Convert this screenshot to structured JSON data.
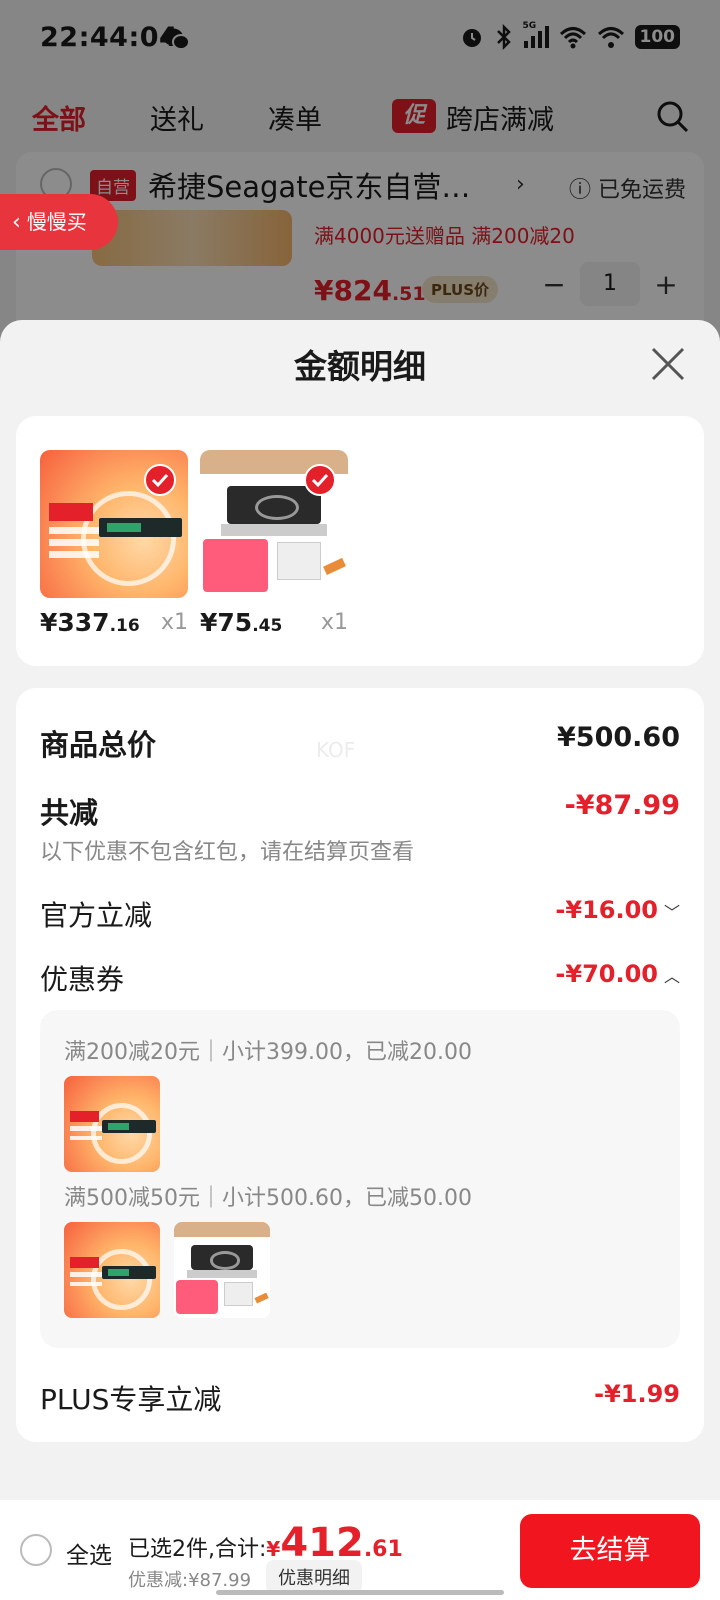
{
  "status_bar": {
    "time": "22:44:04",
    "battery": "100",
    "network": "5G"
  },
  "tabs": [
    {
      "label": "全部",
      "active": true
    },
    {
      "label": "送礼",
      "active": false
    },
    {
      "label": "凑单",
      "active": false
    },
    {
      "label": "跨店满减",
      "active": false,
      "badge": "促"
    }
  ],
  "background_shop": {
    "self_badge": "自营",
    "name": "希捷Seagate京东自营…",
    "shipping": "已免运费",
    "promo": "满4000元送赠品  满200减20",
    "price_main": "¥824",
    "price_decimal": ".51",
    "plus_tag": "PLUS价",
    "quantity": "1",
    "minus": "−",
    "plus": "+"
  },
  "slow_buy": {
    "label": "慢慢买"
  },
  "sheet": {
    "title": "金额明细",
    "goods": [
      {
        "price_main": "¥337",
        "price_decimal": ".16",
        "qty": "x1",
        "image": "seagate-ssd"
      },
      {
        "price_main": "¥75",
        "price_decimal": ".45",
        "qty": "x1",
        "image": "portable-stove"
      }
    ],
    "details": {
      "total_label": "商品总价",
      "total_value": "¥500.60",
      "reduce_label": "共减",
      "reduce_value": "-¥87.99",
      "reduce_note": "以下优惠不包含红包，请在结算页查看",
      "official_label": "官方立减",
      "official_value": "-¥16.00",
      "coupon_label": "优惠券",
      "coupon_value": "-¥70.00",
      "coupon_rules": [
        {
          "text": "满200减20元｜小计399.00，已减20.00"
        },
        {
          "text": "满500减50元｜小计500.60，已减50.00"
        }
      ],
      "plus_label": "PLUS专享立减",
      "plus_value": "-¥1.99",
      "watermark": "KOF"
    }
  },
  "bottom_bar": {
    "select_all": "全选",
    "selected_text": "已选2件,合计:",
    "yen": "¥",
    "total_main": "412",
    "total_decimal": ".61",
    "discount_text": "优惠减:¥87.99",
    "detail_button": "优惠明细",
    "checkout": "去结算"
  },
  "colors": {
    "accent": "#e4202b",
    "checkout": "#f1151f",
    "overlay": "rgba(0,0,0,0.45)"
  }
}
